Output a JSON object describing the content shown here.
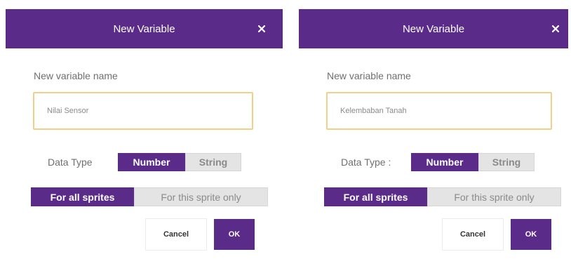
{
  "colors": {
    "accent": "#5b2b8a",
    "input_border": "#f1d08a",
    "toggle_off": "#e4e4e4"
  },
  "dialogs": [
    {
      "title": "New Variable",
      "close_icon": "close-icon",
      "name_label": "New variable name",
      "name_value": "Nilai Sensor",
      "data_type_label": "Data Type",
      "data_type_options": [
        "Number",
        "String"
      ],
      "data_type_selected": "Number",
      "scope_options": [
        "For all sprites",
        "For this sprite only"
      ],
      "scope_selected": "For all sprites",
      "cancel_label": "Cancel",
      "ok_label": "OK"
    },
    {
      "title": "New Variable",
      "close_icon": "close-icon",
      "name_label": "New variable name",
      "name_value": "Kelembaban Tanah",
      "data_type_label": "Data Type :",
      "data_type_options": [
        "Number",
        "String"
      ],
      "data_type_selected": "Number",
      "scope_options": [
        "For all sprites",
        "For this sprite only"
      ],
      "scope_selected": "For all sprites",
      "cancel_label": "Cancel",
      "ok_label": "OK"
    }
  ]
}
